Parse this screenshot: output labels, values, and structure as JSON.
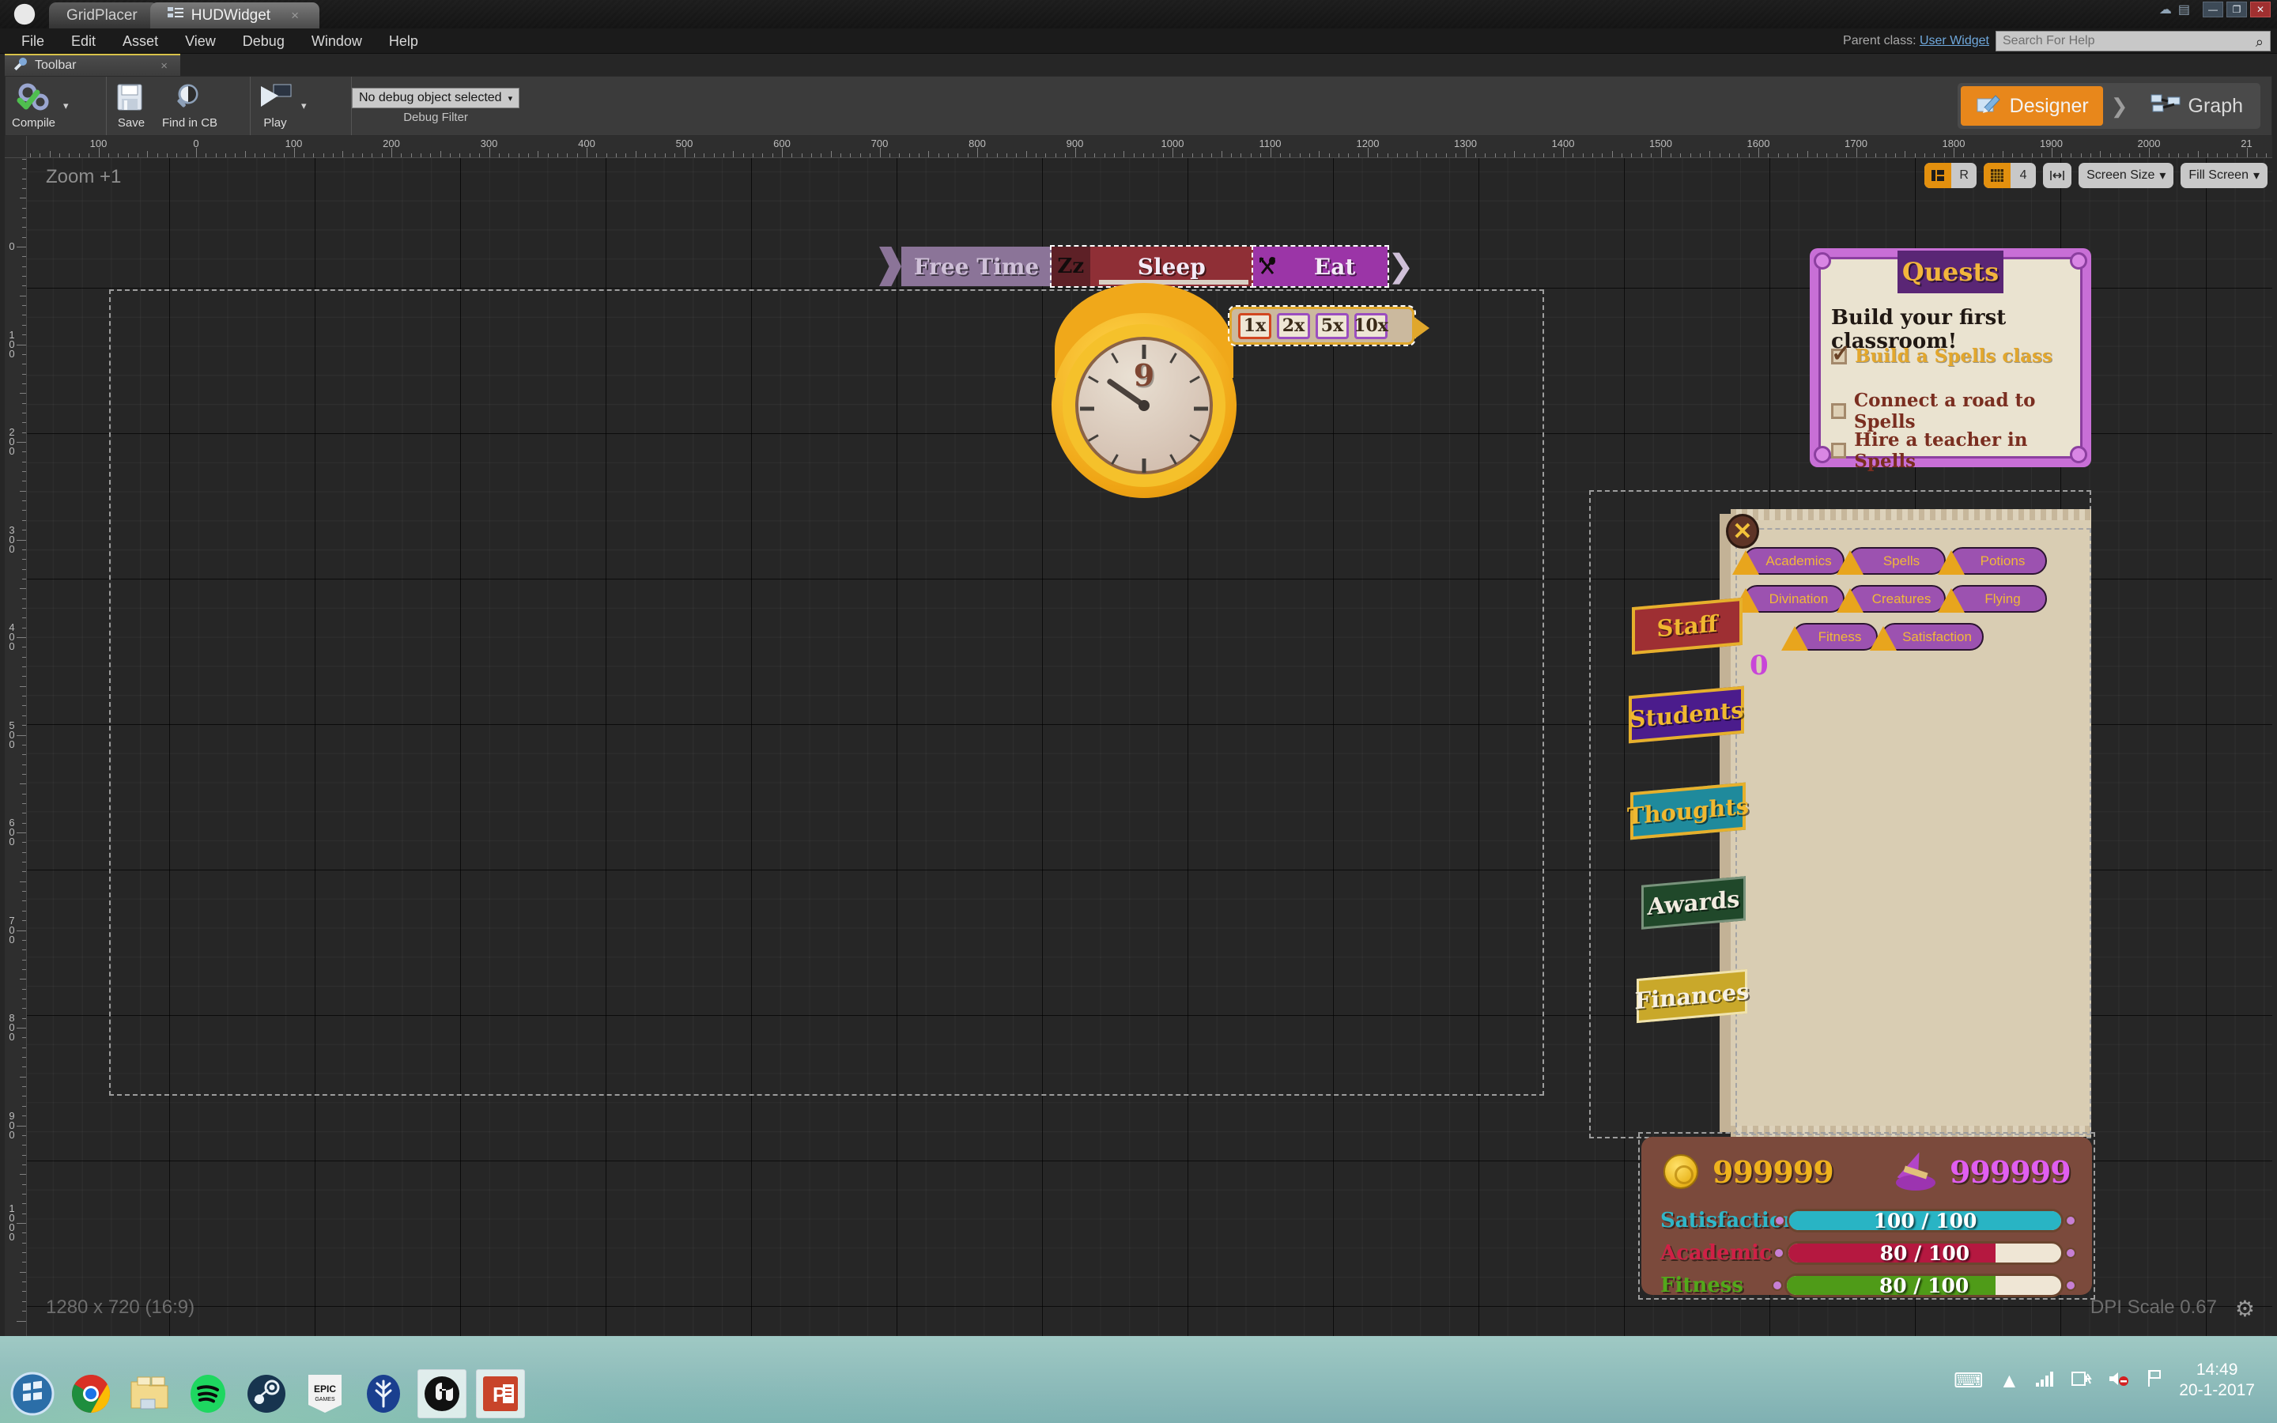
{
  "window": {
    "app_icon": "unreal-logo",
    "tabs": [
      {
        "label": "GridPlacer",
        "icon": "",
        "active": false
      },
      {
        "label": "HUDWidget",
        "icon": "widget-icon",
        "active": true
      }
    ],
    "tab_close": "×",
    "controls": {
      "minimize": "—",
      "maximize": "❐",
      "close": "✕"
    }
  },
  "menubar": {
    "items": [
      "File",
      "Edit",
      "Asset",
      "View",
      "Debug",
      "Window",
      "Help"
    ],
    "parent_class_label": "Parent class:",
    "parent_class_value": "User Widget",
    "search_placeholder": "Search For Help",
    "search_icon": "magnifier-icon"
  },
  "toolbar": {
    "panel_tab_label": "Toolbar",
    "panel_tab_icon": "wrench-icon",
    "panel_tab_close": "×",
    "compile_label": "Compile",
    "compile_icon": "gears-check-icon",
    "compile_caret": "▾",
    "save_label": "Save",
    "save_icon": "floppy-icon",
    "find_label": "Find in CB",
    "find_icon": "magnifier-icon",
    "play_label": "Play",
    "play_icon": "play-icon",
    "play_caret": "▾",
    "debug_object": "No debug object selected",
    "debug_caret": "▾",
    "debug_filter_caption": "Debug Filter",
    "mode_designer": "Designer",
    "mode_designer_icon": "designer-pencil-icon",
    "mode_separator": "❯",
    "mode_graph": "Graph",
    "mode_graph_icon": "graph-nodes-icon",
    "accent_orange": "#e8871b"
  },
  "canvas": {
    "zoom_label": "Zoom +1",
    "resolution_label": "1280 x 720 (16:9)",
    "dpi_label": "DPI Scale 0.67",
    "dpi_gear_icon": "gear-icon",
    "ruler_h_labels": [
      "100",
      "0",
      "100",
      "200",
      "300",
      "400",
      "500",
      "600",
      "700",
      "800",
      "900",
      "1000",
      "1100",
      "1200",
      "1300",
      "1400",
      "1500",
      "1600",
      "1700",
      "1800",
      "1900",
      "2000",
      "21"
    ],
    "ruler_v_labels": [
      "0",
      "100",
      "200",
      "300",
      "400",
      "500",
      "600",
      "700",
      "800",
      "900",
      "1000"
    ],
    "tools": {
      "layout_icon": "layout-icon",
      "r_label": "R",
      "grid_icon": "grid-icon",
      "grid_value": "4",
      "grid_caret": "▾",
      "fill_icon": "resize-icon",
      "screen_size_label": "Screen Size",
      "screen_size_caret": "▾",
      "fill_screen_label": "Fill Screen",
      "fill_screen_caret": "▾"
    }
  },
  "hud": {
    "activity_bar": {
      "items": [
        {
          "label": "Free Time",
          "color": "#8b7498",
          "icon": ""
        },
        {
          "label": "Sleep",
          "color": "#8f2f36",
          "icon": "zzz-icon",
          "icon_text": "Zz"
        },
        {
          "label": "Eat",
          "color": "#9b35a7",
          "icon": "fork-spoon-icon",
          "icon_text": "✕"
        }
      ]
    },
    "clock": {
      "hour_label": "9"
    },
    "speed": {
      "options": [
        "1x",
        "2x",
        "5x",
        "10x"
      ],
      "selected": "1x"
    },
    "quests": {
      "title": "Quests",
      "headline": "Build your first classroom!",
      "items": [
        {
          "label": "Build a Spells class",
          "done": true
        },
        {
          "label": "Connect a road to Spells",
          "done": false
        },
        {
          "label": "Hire a teacher in Spells",
          "done": false
        }
      ]
    },
    "panel": {
      "close_icon": "close-x-icon",
      "close_label": "✕",
      "categories": [
        [
          "Academics",
          "Spells",
          "Potions"
        ],
        [
          "Divination",
          "Creatures",
          "Flying"
        ],
        [
          "Fitness",
          "Satisfaction"
        ]
      ],
      "counter": "0",
      "side_tabs": [
        {
          "label": "Staff",
          "bg": "#9e2f33",
          "fg": "#f0b830",
          "border": "#e6b02c"
        },
        {
          "label": "Students",
          "bg": "#4b1c8c",
          "fg": "#f0b830",
          "border": "#e6b02c"
        },
        {
          "label": "Thoughts",
          "bg": "#1f8a9c",
          "fg": "#f0b830",
          "border": "#e6b02c"
        },
        {
          "label": "Awards",
          "bg": "#20482a",
          "fg": "#f2ece0",
          "border": "#79937c"
        },
        {
          "label": "Finances",
          "bg": "#c9a82a",
          "fg": "#f6f0e2",
          "border": "#f0e3ae"
        }
      ]
    },
    "resources": {
      "gold_icon": "coin-icon",
      "gold_value": "999999",
      "mana_icon": "wizard-hat-icon",
      "mana_value": "999999",
      "stats": [
        {
          "label": "Satisfaction",
          "value": "100 / 100",
          "pct": 100,
          "color": "#29b4c4",
          "label_color": "#2fb6c8"
        },
        {
          "label": "Academic",
          "value": "80 / 100",
          "pct": 76,
          "color": "#b51840",
          "label_color": "#cf2046"
        },
        {
          "label": "Fitness",
          "value": "80 / 100",
          "pct": 76,
          "color": "#4f9b18",
          "label_color": "#52a81a"
        }
      ]
    }
  },
  "taskbar": {
    "items": [
      {
        "name": "start-orb",
        "label": "⊞"
      },
      {
        "name": "chrome",
        "label": ""
      },
      {
        "name": "file-explorer",
        "label": ""
      },
      {
        "name": "spotify",
        "label": ""
      },
      {
        "name": "steam",
        "label": ""
      },
      {
        "name": "epic-games",
        "label": "EPIC"
      },
      {
        "name": "perforce",
        "label": ""
      },
      {
        "name": "unreal-engine",
        "label": "",
        "active": true
      },
      {
        "name": "powerpoint",
        "label": "P",
        "active": true
      }
    ],
    "tray": {
      "keyboard_icon": "keyboard-icon",
      "expand_icon": "▲",
      "network_icon": "signal-icon",
      "battery_icon": "battery-icon",
      "volume_icon": "mute-icon",
      "flag_icon": "flag-icon",
      "time": "14:49",
      "date": "20-1-2017"
    }
  }
}
